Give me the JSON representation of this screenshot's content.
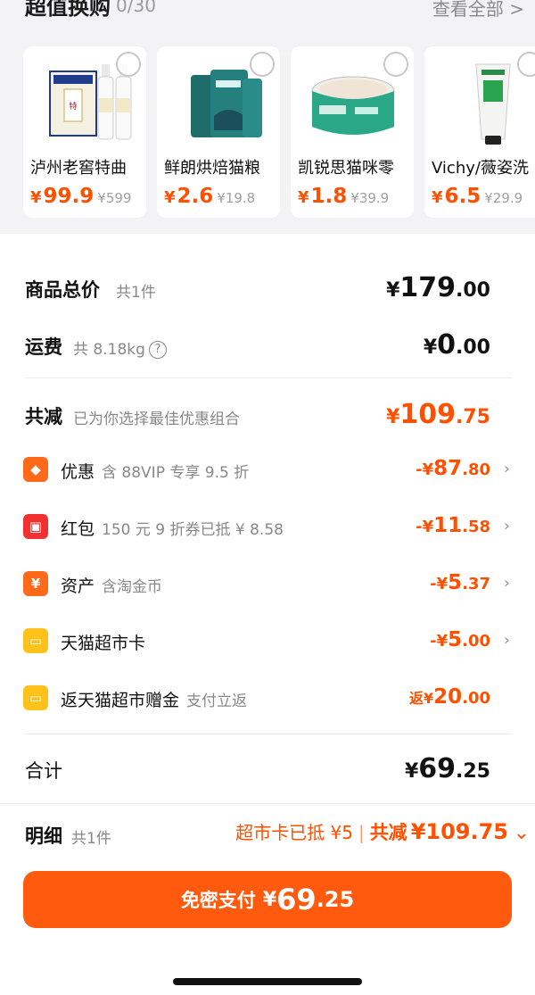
{
  "strip": {
    "title": "超值换购",
    "count": "0/30",
    "view_all": "查看全部 >"
  },
  "cards": [
    {
      "name": "泸州老窖特曲",
      "currency": "¥",
      "price": "99.9",
      "original": "¥599",
      "image": "baijiu-bottles"
    },
    {
      "name": "鲜朗烘焙猫粮",
      "currency": "¥",
      "price": "2.6",
      "original": "¥19.8",
      "image": "cat-food-bags"
    },
    {
      "name": "凯锐思猫咪零",
      "currency": "¥",
      "price": "1.8",
      "original": "¥39.9",
      "image": "cat-food-can"
    },
    {
      "name": "Vichy/薇姿洗",
      "currency": "¥",
      "price": "6.5",
      "original": "¥29.9",
      "image": "cleanser-tube"
    }
  ],
  "summary": {
    "total_label": "商品总价",
    "total_sub": "共1件",
    "total_yen": "¥",
    "total_int": "179",
    "total_dec": ".00",
    "shipping_label": "运费",
    "shipping_sub": "共 8.18kg",
    "shipping_info": "?",
    "shipping_yen": "¥",
    "shipping_int": "0",
    "shipping_dec": ".00",
    "discount_label": "共减",
    "discount_sub": "已为你选择最佳优惠组合",
    "discount_yen": "¥",
    "discount_int": "109",
    "discount_dec": ".75"
  },
  "details": [
    {
      "label": "优惠",
      "sub": "含 88VIP 专享 9.5 折",
      "prefix": "-¥",
      "int": "87",
      "dec": ".80",
      "icon": "tag-icon",
      "color": "#ff6a1a",
      "glyph": "◆",
      "chevron": "›"
    },
    {
      "label": "红包",
      "sub": "150 元 9 折券已抵 ¥ 8.58",
      "prefix": "-¥",
      "int": "11",
      "dec": ".58",
      "icon": "red-packet-icon",
      "color": "#f23030",
      "glyph": "▣",
      "chevron": "›"
    },
    {
      "label": "资产",
      "sub": "含淘金币",
      "prefix": "-¥",
      "int": "5",
      "dec": ".37",
      "icon": "yen-icon",
      "color": "#ff6a1a",
      "glyph": "¥",
      "chevron": "›"
    },
    {
      "label": "天猫超市卡",
      "sub": "",
      "prefix": "-¥",
      "int": "5",
      "dec": ".00",
      "icon": "card-icon",
      "color": "#ffc21a",
      "glyph": "▭",
      "chevron": "›"
    },
    {
      "label": "返天猫超市赠金",
      "sub": "支付立返",
      "prefix": "返¥",
      "int": "20",
      "dec": ".00",
      "icon": "gift-card-icon",
      "color": "#ffc21a",
      "glyph": "▭",
      "chevron": ""
    }
  ],
  "grand": {
    "label": "合计",
    "yen": "¥",
    "int": "69",
    "dec": ".25"
  },
  "bottom": {
    "detail_label": "明细",
    "detail_sub": "共1件",
    "card_used": "超市卡已抵 ¥5",
    "separator": "|",
    "total_reduce_label": "共减",
    "total_reduce": "¥109.75",
    "chevron": "⌄"
  },
  "pay": {
    "label": "免密支付",
    "yen": "¥",
    "int": "69",
    "dec": ".25"
  },
  "colors": {
    "accent": "#ff5000",
    "pay_button": "#ff5a0d"
  }
}
